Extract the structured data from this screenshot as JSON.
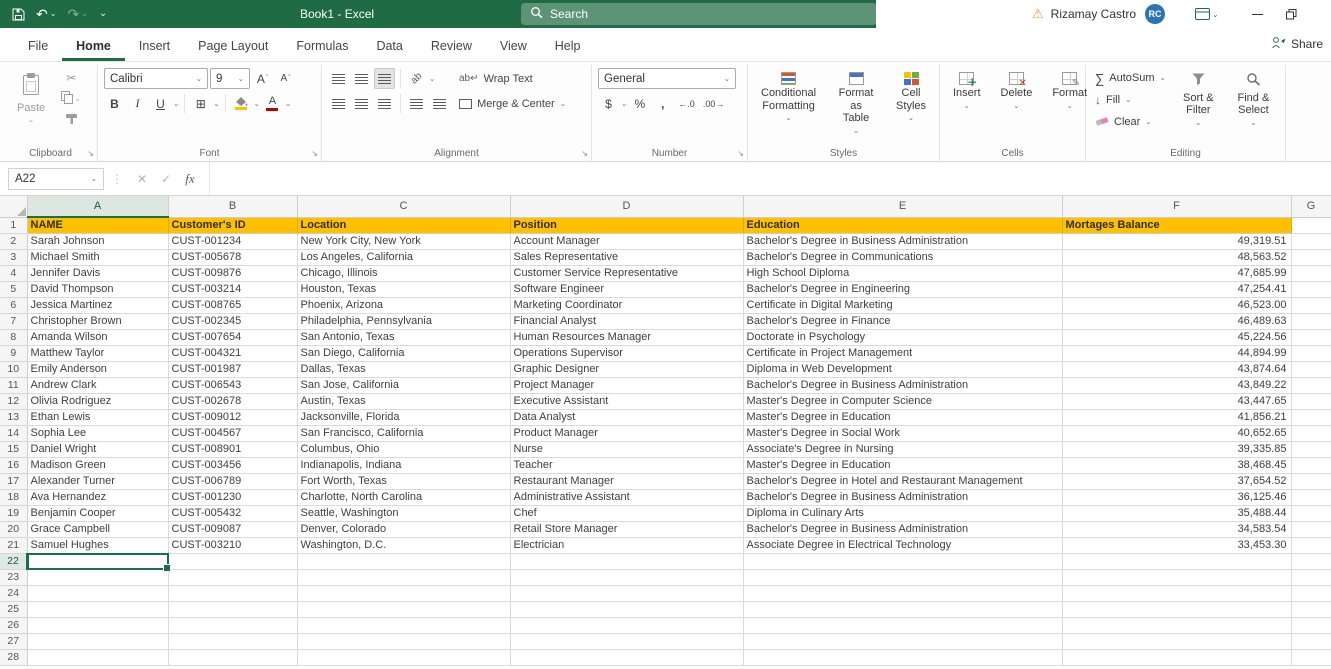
{
  "titlebar": {
    "title": "Book1 - Excel",
    "search_placeholder": "Search",
    "user_name": "Rizamay Castro",
    "user_initials": "RC"
  },
  "tabs": {
    "items": [
      "File",
      "Home",
      "Insert",
      "Page Layout",
      "Formulas",
      "Data",
      "Review",
      "View",
      "Help"
    ],
    "active": "Home",
    "share_label": "Share"
  },
  "ribbon": {
    "clipboard": {
      "label": "Clipboard",
      "paste": "Paste"
    },
    "font": {
      "label": "Font",
      "name": "Calibri",
      "size": "9"
    },
    "alignment": {
      "label": "Alignment",
      "wrap": "Wrap Text",
      "merge": "Merge & Center"
    },
    "number": {
      "label": "Number",
      "format": "General"
    },
    "styles": {
      "label": "Styles",
      "buttons": [
        "Conditional Formatting",
        "Format as Table",
        "Cell Styles"
      ]
    },
    "cells": {
      "label": "Cells",
      "buttons": [
        "Insert",
        "Delete",
        "Format"
      ]
    },
    "editing": {
      "label": "Editing",
      "autosum": "AutoSum",
      "fill": "Fill",
      "clear": "Clear",
      "sort": "Sort & Filter",
      "find": "Find & Select"
    }
  },
  "formula_bar": {
    "name_box": "A22",
    "fx": "fx",
    "formula": ""
  },
  "sheet": {
    "columns": [
      "A",
      "B",
      "C",
      "D",
      "E",
      "F",
      "G"
    ],
    "selected_column": "A",
    "selected_row": 22,
    "active_cell": "A22",
    "header_fill": "#FFC000",
    "accent_green": "#1A7044",
    "headers": [
      "NAME",
      "Customer's ID",
      "Location",
      "Position",
      "Education",
      "Mortages Balance"
    ],
    "rows": [
      [
        "Sarah Johnson",
        "CUST-001234",
        "New York City, New York",
        "Account Manager",
        "Bachelor's Degree in Business Administration",
        "49,319.51"
      ],
      [
        "Michael Smith",
        "CUST-005678",
        "Los Angeles, California",
        "Sales Representative",
        "Bachelor's Degree in Communications",
        "48,563.52"
      ],
      [
        "Jennifer Davis",
        "CUST-009876",
        "Chicago, Illinois",
        "Customer Service Representative",
        "High School Diploma",
        "47,685.99"
      ],
      [
        "David Thompson",
        "CUST-003214",
        "Houston, Texas",
        "Software Engineer",
        "Bachelor's Degree in Engineering",
        "47,254.41"
      ],
      [
        "Jessica Martinez",
        "CUST-008765",
        "Phoenix, Arizona",
        "Marketing Coordinator",
        "Certificate in Digital Marketing",
        "46,523.00"
      ],
      [
        "Christopher Brown",
        "CUST-002345",
        "Philadelphia, Pennsylvania",
        "Financial Analyst",
        "Bachelor's Degree in Finance",
        "46,489.63"
      ],
      [
        "Amanda Wilson",
        "CUST-007654",
        "San Antonio, Texas",
        "Human Resources Manager",
        "Doctorate in Psychology",
        "45,224.56"
      ],
      [
        "Matthew Taylor",
        "CUST-004321",
        "San Diego, California",
        "Operations Supervisor",
        "Certificate in Project Management",
        "44,894.99"
      ],
      [
        "Emily Anderson",
        "CUST-001987",
        "Dallas, Texas",
        "Graphic Designer",
        "Diploma in Web Development",
        "43,874.64"
      ],
      [
        "Andrew Clark",
        "CUST-006543",
        "San Jose, California",
        "Project Manager",
        "Bachelor's Degree in Business Administration",
        "43,849.22"
      ],
      [
        "Olivia Rodriguez",
        "CUST-002678",
        "Austin, Texas",
        "Executive Assistant",
        "Master's Degree in Computer Science",
        "43,447.65"
      ],
      [
        "Ethan Lewis",
        "CUST-009012",
        "Jacksonville, Florida",
        "Data Analyst",
        "Master's Degree in Education",
        "41,856.21"
      ],
      [
        "Sophia Lee",
        "CUST-004567",
        "San Francisco, California",
        "Product Manager",
        "Master's Degree in Social Work",
        "40,652.65"
      ],
      [
        "Daniel Wright",
        "CUST-008901",
        "Columbus, Ohio",
        "Nurse",
        "Associate's Degree in Nursing",
        "39,335.85"
      ],
      [
        "Madison Green",
        "CUST-003456",
        "Indianapolis, Indiana",
        "Teacher",
        "Master's Degree in Education",
        "38,468.45"
      ],
      [
        "Alexander Turner",
        "CUST-006789",
        "Fort Worth, Texas",
        "Restaurant Manager",
        "Bachelor's Degree in Hotel and Restaurant Management",
        "37,654.52"
      ],
      [
        "Ava Hernandez",
        "CUST-001230",
        "Charlotte, North Carolina",
        "Administrative Assistant",
        "Bachelor's Degree in Business Administration",
        "36,125.46"
      ],
      [
        "Benjamin Cooper",
        "CUST-005432",
        "Seattle, Washington",
        "Chef",
        "Diploma in Culinary Arts",
        "35,488.44"
      ],
      [
        "Grace Campbell",
        "CUST-009087",
        "Denver, Colorado",
        "Retail Store Manager",
        "Bachelor's Degree in Business Administration",
        "34,583.54"
      ],
      [
        "Samuel Hughes",
        "CUST-003210",
        "Washington, D.C.",
        "Electrician",
        "Associate Degree in Electrical Technology",
        "33,453.30"
      ]
    ],
    "total_visible_rows": 28
  }
}
